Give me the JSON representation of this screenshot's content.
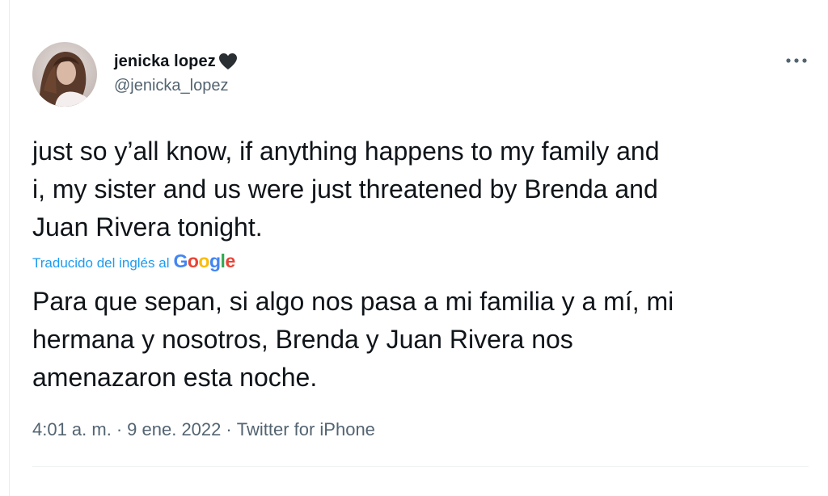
{
  "user": {
    "display_name": "jenicka lopez",
    "name_emoji": "black-heart-icon",
    "handle": "@jenicka_lopez"
  },
  "tweet": {
    "line1": "just so y’all know, if anything happens to my family and",
    "line2": "i, my sister and us were just threatened by Brenda and",
    "line3": "Juan Rivera tonight."
  },
  "translation": {
    "label": "Traducido del inglés al",
    "provider": "Google",
    "line1": "Para que sepan, si algo nos pasa a mi familia y a mí, mi",
    "line2": "hermana y nosotros, Brenda y Juan Rivera nos",
    "line3": "amenazaron esta noche."
  },
  "meta": {
    "time": "4:01 a. m.",
    "sep": "·",
    "date": "9 ene. 2022",
    "source": "Twitter for iPhone"
  },
  "colors": {
    "link_blue": "#1d9bf0",
    "secondary_text": "#536471",
    "primary_text": "#0f1419",
    "google_blue": "#4285f4",
    "google_red": "#ea4335",
    "google_yellow": "#fbbc05",
    "google_green": "#34a853"
  },
  "icons": [
    "more-options-icon",
    "black-heart-icon",
    "avatar"
  ]
}
